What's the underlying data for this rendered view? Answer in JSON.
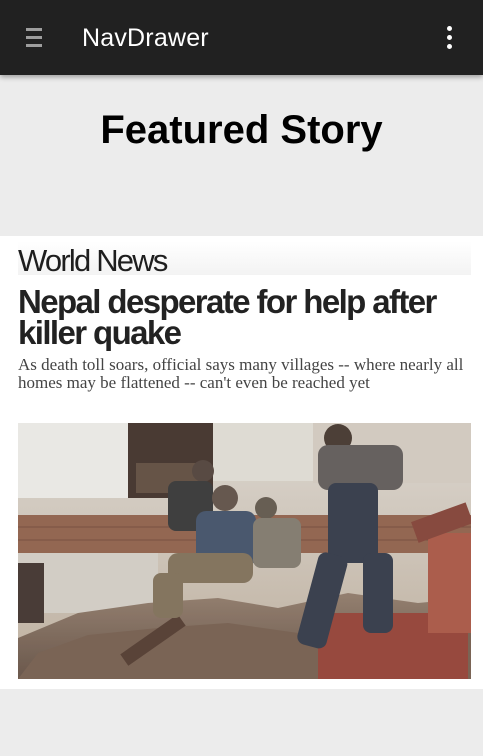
{
  "appbar": {
    "title": "NavDrawer",
    "menu_icon": "hamburger-menu-icon",
    "overflow_icon": "more-vert-icon"
  },
  "page": {
    "section_title": "Featured Story"
  },
  "story": {
    "masthead": "World News",
    "headline": "Nepal desperate for help after killer quake",
    "subhead": "As death toll soars, official says many villages -- where nearly all homes may be flattened -- can't even be reached yet",
    "image_subject": "rescue workers digging through earthquake rubble"
  },
  "colors": {
    "appbar": "#212121",
    "background": "#ececec",
    "card": "#ffffff"
  }
}
